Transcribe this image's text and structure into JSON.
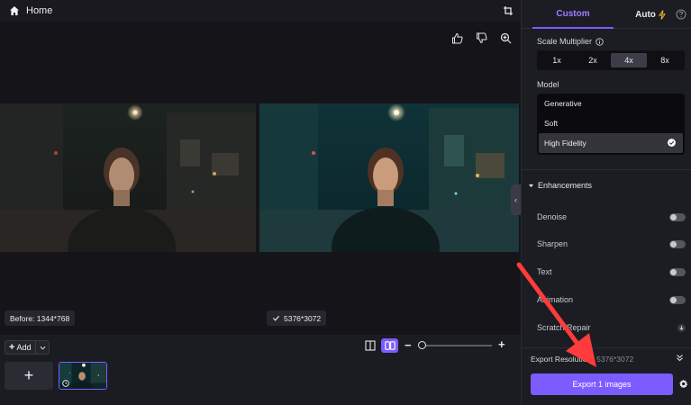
{
  "topbar": {
    "home_label": "Home",
    "home_icon": "home-icon",
    "crop_icon": "crop-icon"
  },
  "stage": {
    "tools": [
      "thumbs-up-icon",
      "thumbs-down-icon",
      "zoom-in-icon"
    ],
    "before_label": "Before: 1344*768",
    "after_label": "5376*3072"
  },
  "bottombar": {
    "add_label": "Add",
    "add_tile_symbol": "+",
    "zoom_minus": "−",
    "zoom_plus": "+",
    "zoom_level": 0.0
  },
  "panel": {
    "tabs": {
      "custom": "Custom",
      "auto": "Auto"
    },
    "scale": {
      "title": "Scale Multiplier",
      "options": [
        "1x",
        "2x",
        "4x",
        "8x"
      ],
      "selected": "4x"
    },
    "model": {
      "title": "Model",
      "options": [
        "Generative",
        "Soft",
        "High Fidelity"
      ],
      "selected": "High Fidelity"
    },
    "enhancements": {
      "title": "Enhancements",
      "items": [
        {
          "label": "Denoise",
          "on": false
        },
        {
          "label": "Sharpen",
          "on": false
        },
        {
          "label": "Text",
          "on": false
        },
        {
          "label": "Animation",
          "on": false
        },
        {
          "label": "Scratch Repair",
          "control": "download-icon"
        }
      ]
    },
    "export_resolution": {
      "label": "Export Resolution",
      "value": "5376*3072"
    },
    "export_button": "Export 1 images"
  },
  "colors": {
    "accent": "#7b5cff",
    "annotation": "#ff3b3b"
  }
}
